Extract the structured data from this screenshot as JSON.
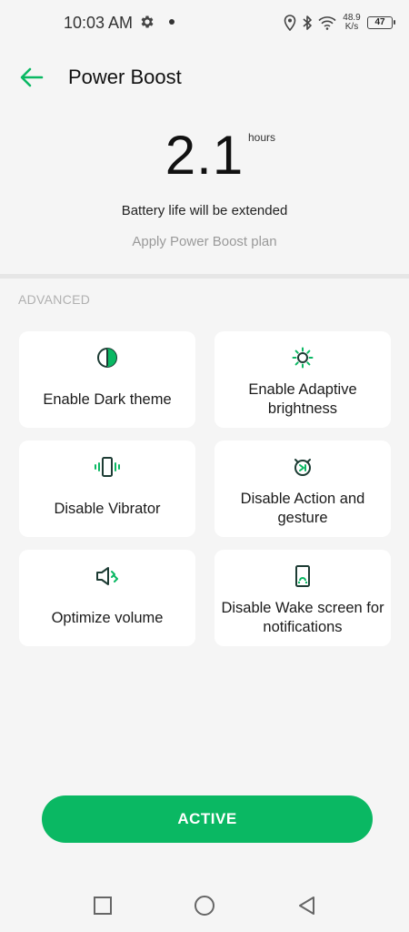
{
  "status_bar": {
    "time": "10:03 AM",
    "net_speed_value": "48.9",
    "net_speed_unit": "K/s",
    "battery": "47"
  },
  "header": {
    "title": "Power Boost"
  },
  "boost": {
    "value": "2.1",
    "unit": "hours",
    "description": "Battery life will be extended",
    "apply_label": "Apply Power Boost plan"
  },
  "section": {
    "label": "ADVANCED"
  },
  "cards": [
    {
      "label": "Enable Dark theme",
      "icon": "dark-theme-icon"
    },
    {
      "label": "Enable Adaptive brightness",
      "icon": "brightness-icon"
    },
    {
      "label": "Disable Vibrator",
      "icon": "vibration-icon"
    },
    {
      "label": "Disable Action and gesture",
      "icon": "gesture-icon"
    },
    {
      "label": "Optimize volume",
      "icon": "volume-icon"
    },
    {
      "label": "Disable Wake screen for notifications",
      "icon": "wake-screen-icon"
    }
  ],
  "active_button": {
    "label": "ACTIVE"
  },
  "colors": {
    "accent": "#0ab863",
    "background": "#f5f5f5",
    "card": "#ffffff"
  }
}
